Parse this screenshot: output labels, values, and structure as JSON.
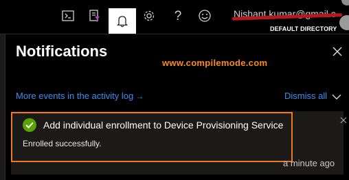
{
  "header": {
    "icons": [
      {
        "name": "cloud-shell-icon"
      },
      {
        "name": "directory-filter-icon"
      },
      {
        "name": "notifications-bell-icon",
        "active": true
      },
      {
        "name": "settings-gear-icon"
      },
      {
        "name": "help-question-icon",
        "glyph": "?"
      },
      {
        "name": "feedback-smiley-icon"
      }
    ],
    "account": {
      "email": "Nishant.kumar@gmail.com",
      "directory": "DEFAULT DIRECTORY"
    }
  },
  "notifications_panel": {
    "title": "Notifications",
    "watermark": "www.compilemode.com",
    "activity_link": "More events in the activity log",
    "activity_arrow": "→",
    "dismiss_all": "Dismiss all",
    "items": [
      {
        "status": "success",
        "title": "Add individual enrollment to Device Provisioning Service",
        "message": "Enrolled successfully.",
        "time": "a minute ago"
      }
    ]
  },
  "colors": {
    "background": "#000000",
    "card": "#1b1a19",
    "link": "#3b8ef0",
    "success": "#57a300",
    "highlight": "#f07a24",
    "watermark": "#ff8c1a",
    "redaction": "#b5191f"
  }
}
